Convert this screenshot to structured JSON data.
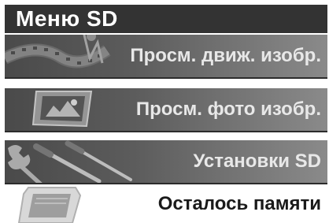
{
  "header": {
    "title": "Меню SD"
  },
  "menu": {
    "items": [
      {
        "label": "Просм. движ. изобр.",
        "icon": "film-reel-icon"
      },
      {
        "label": "Просм. фото изобр.",
        "icon": "photo-frame-icon"
      },
      {
        "label": "Установки SD",
        "icon": "tools-icon"
      }
    ],
    "selected": {
      "label": "Осталось памяти",
      "icon": "sd-card-icon"
    }
  },
  "colors": {
    "header_bg": "#333333",
    "item_bg_dark": "#4a4a4a",
    "item_bg_light": "#8a8a8a",
    "item_text": "#e8e8e8",
    "selected_text": "#1a1a1a"
  }
}
